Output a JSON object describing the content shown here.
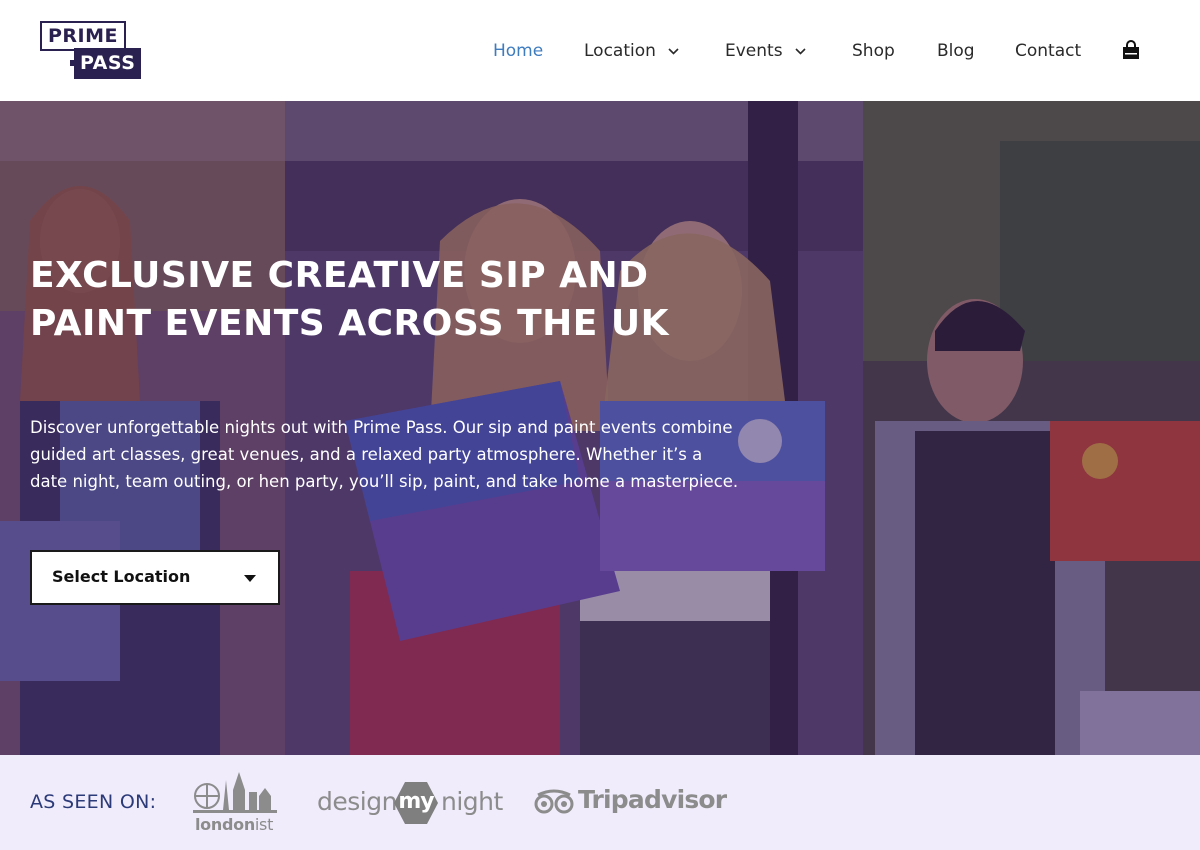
{
  "brand": {
    "logo_line1": "PRIME",
    "logo_line2": "PASS",
    "primary_color": "#2b2150"
  },
  "nav": {
    "items": [
      {
        "label": "Home",
        "active": true
      },
      {
        "label": "Location",
        "has_dropdown": true
      },
      {
        "label": "Events",
        "has_dropdown": true
      },
      {
        "label": "Shop"
      },
      {
        "label": "Blog"
      },
      {
        "label": "Contact"
      }
    ],
    "cart_icon": "shopping-bag-icon",
    "active_color": "#3f7cbf"
  },
  "hero": {
    "title": "EXCLUSIVE CREATIVE SIP AND PAINT EVENTS ACROSS THE UK",
    "description": "Discover unforgettable nights out with Prime Pass. Our sip and paint events combine guided art classes, great venues, and a relaxed party atmosphere. Whether it’s a date night, team outing, or hen party, you’ll sip, paint, and take home a masterpiece.",
    "select": {
      "label": "Select Location"
    }
  },
  "seen_on": {
    "label": "AS SEEN ON:",
    "logos": {
      "londonist": {
        "part1": "london",
        "part2": "ist"
      },
      "designmynight": {
        "part1": "design",
        "part2": "my",
        "part3": "night"
      },
      "tripadvisor": {
        "text": "Tripadvisor"
      }
    },
    "background": "#f1ecfb"
  }
}
